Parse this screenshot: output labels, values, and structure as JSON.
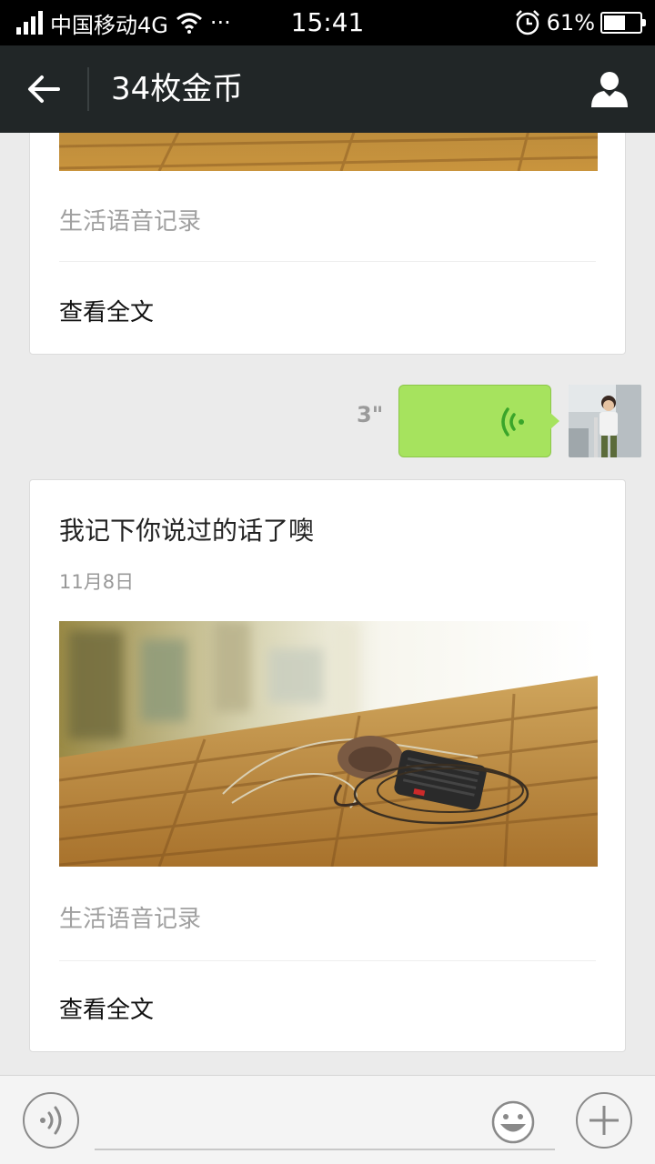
{
  "status_bar": {
    "carrier": "中国移动4G",
    "more": "···",
    "time": "15:41",
    "battery_percent": "61%",
    "battery_level": 0.61
  },
  "header": {
    "title": "34枚金币",
    "back_icon": "arrow-left-icon",
    "profile_icon": "person-icon"
  },
  "messages": {
    "top_card": {
      "description": "生活语音记录",
      "link": "查看全文"
    },
    "voice": {
      "duration": "3\""
    },
    "main_card": {
      "title": "我记下你说过的话了噢",
      "date": "11月8日",
      "description": "生活语音记录",
      "link": "查看全文"
    }
  },
  "input_bar": {
    "placeholder": "",
    "voice_icon": "voice-mode-icon",
    "emoji_icon": "smiley-icon",
    "plus_icon": "plus-icon"
  },
  "colors": {
    "header_bg": "#212627",
    "voice_bubble": "#a6e35e",
    "voice_wave": "#3aa52a",
    "page_bg": "#ebebeb"
  }
}
